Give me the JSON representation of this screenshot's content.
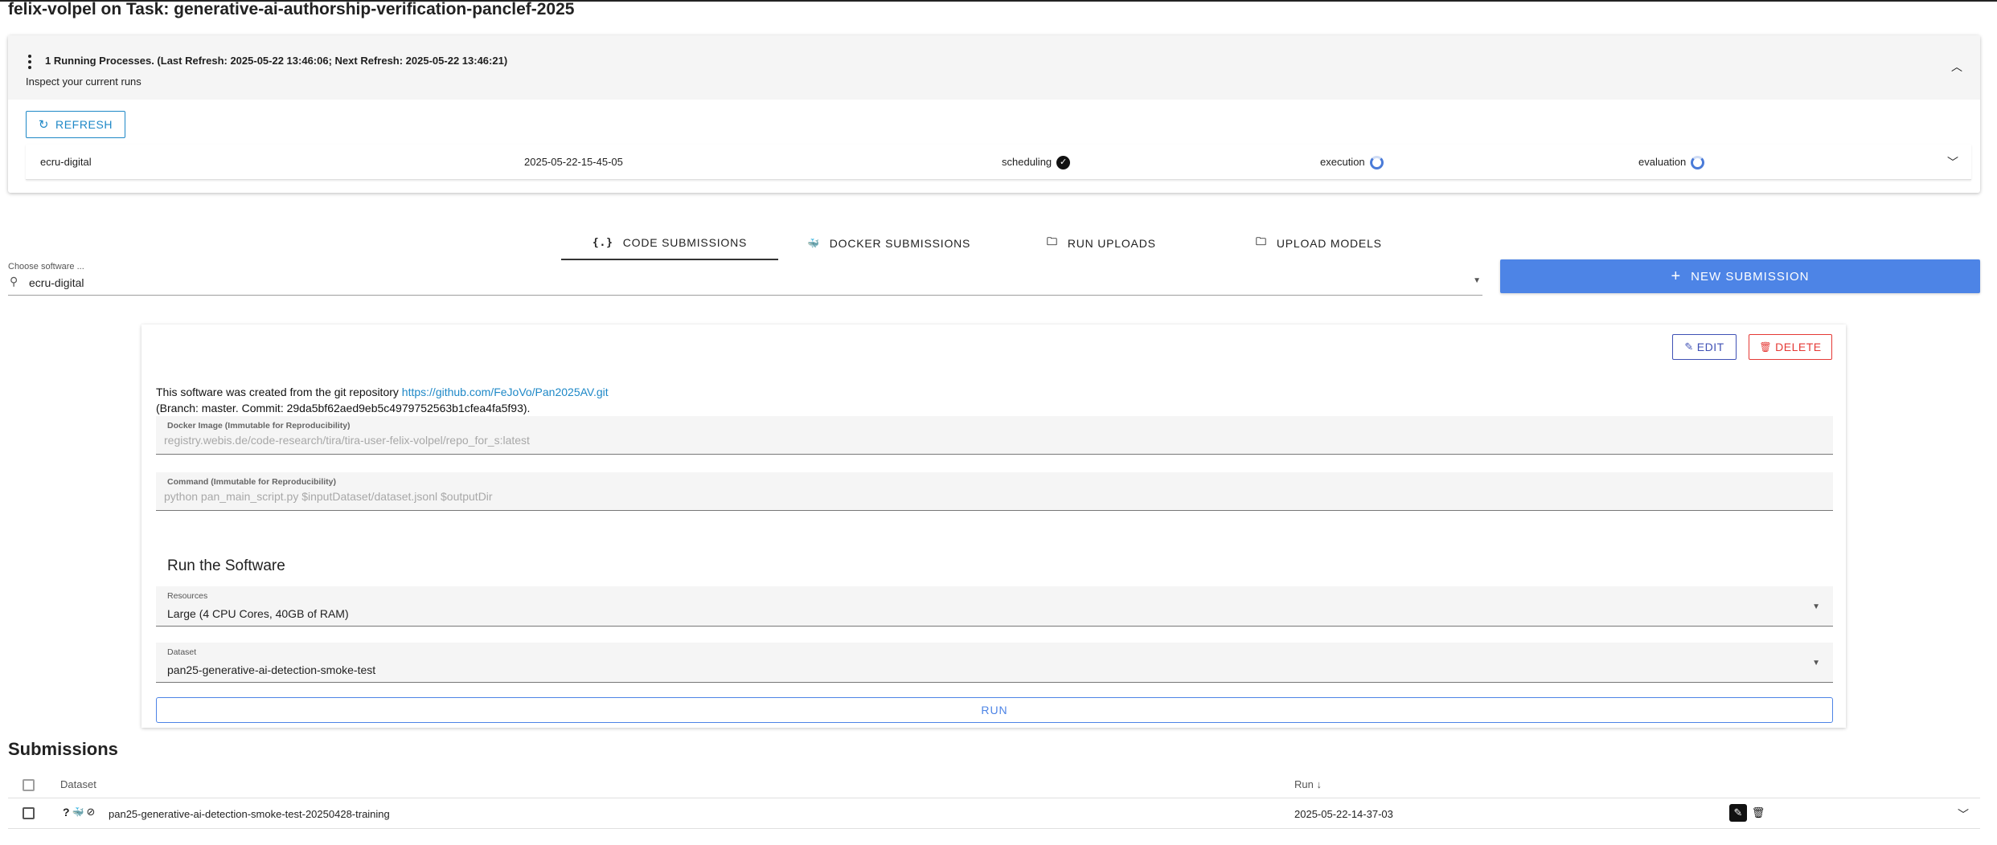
{
  "header": {
    "user": "felix-volpel",
    "title_rest": " on Task: generative-ai-authorship-verification-panclef-2025"
  },
  "processes": {
    "title": "1 Running Processes. (Last Refresh: 2025-05-22 13:46:06; Next Refresh: 2025-05-22 13:46:21)",
    "subtitle": "Inspect your current runs",
    "refresh_label": "REFRESH",
    "runs": [
      {
        "software": "ecru-digital",
        "run_id": "2025-05-22-15-45-05",
        "scheduling_label": "scheduling",
        "scheduling_status": "done",
        "execution_label": "execution",
        "execution_status": "running",
        "evaluation_label": "evaluation",
        "evaluation_status": "running"
      }
    ]
  },
  "tabs": [
    {
      "label": "CODE SUBMISSIONS",
      "icon": "code-braces-icon",
      "glyph": "{.}",
      "active": true
    },
    {
      "label": "DOCKER SUBMISSIONS",
      "icon": "docker-icon",
      "glyph": "🐳",
      "active": false
    },
    {
      "label": "RUN UPLOADS",
      "icon": "folder-upload-icon",
      "glyph": "🗀",
      "active": false
    },
    {
      "label": "UPLOAD MODELS",
      "icon": "folder-upload-icon",
      "glyph": "🗀",
      "active": false
    }
  ],
  "chooser": {
    "label": "Choose software ...",
    "value": "ecru-digital"
  },
  "new_submission_label": "NEW SUBMISSION",
  "software": {
    "edit_label": "EDIT",
    "delete_label": "DELETE",
    "info_prefix": "This software was created from the git repository ",
    "repo_url": "https://github.com/FeJoVo/Pan2025AV.git",
    "branch_line": "(Branch: master. Commit: 29da5bf62aed9eb5c4979752563b1cfea4fa5f93).",
    "docker_label": "Docker Image (Immutable for Reproducibility)",
    "docker_value": "registry.webis.de/code-research/tira/tira-user-felix-volpel/repo_for_s:latest",
    "command_label": "Command (Immutable for Reproducibility)",
    "command_value": "python pan_main_script.py $inputDataset/dataset.jsonl $outputDir",
    "run_title": "Run the Software",
    "resources_label": "Resources",
    "resources_value": "Large (4 CPU Cores, 40GB of RAM)",
    "dataset_label": "Dataset",
    "dataset_value": "pan25-generative-ai-detection-smoke-test",
    "run_label": "RUN"
  },
  "submissions": {
    "title": "Submissions",
    "columns": {
      "dataset": "Dataset",
      "run": "Run"
    },
    "rows": [
      {
        "dataset": "pan25-generative-ai-detection-smoke-test-20250428-training",
        "run": "2025-05-22-14-37-03",
        "status_icons": [
          "question-icon",
          "docker-icon",
          "eye-off-icon"
        ]
      }
    ]
  },
  "colors": {
    "accent": "#4d84e6",
    "link": "#1e88c7",
    "delete": "#e53935",
    "edit": "#3f51b5"
  }
}
